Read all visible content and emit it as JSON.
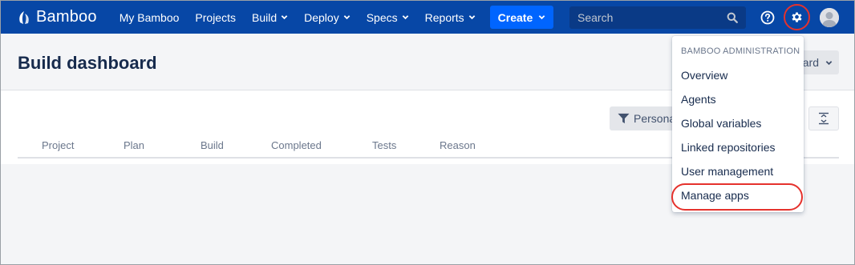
{
  "app": {
    "name": "Bamboo"
  },
  "nav": {
    "items": [
      {
        "label": "My Bamboo",
        "dropdown": false
      },
      {
        "label": "Projects",
        "dropdown": false
      },
      {
        "label": "Build",
        "dropdown": true
      },
      {
        "label": "Deploy",
        "dropdown": true
      },
      {
        "label": "Specs",
        "dropdown": true
      },
      {
        "label": "Reports",
        "dropdown": true
      }
    ],
    "create_label": "Create",
    "search_placeholder": "Search"
  },
  "page": {
    "title": "Build dashboard",
    "header_button_label": "ard"
  },
  "toolbar": {
    "filter_label": "Personal"
  },
  "table": {
    "columns": [
      "Project",
      "Plan",
      "Build",
      "Completed",
      "Tests",
      "Reason"
    ]
  },
  "admin_menu": {
    "heading": "BAMBOO ADMINISTRATION",
    "items": [
      "Overview",
      "Agents",
      "Global variables",
      "Linked repositories",
      "User management",
      "Manage apps"
    ],
    "highlighted": "Manage apps"
  },
  "colors": {
    "nav_bg": "#0747a6",
    "create_bg": "#0065ff",
    "highlight_ring": "#e5322d"
  },
  "icons": {
    "logo": "bamboo-logo-icon",
    "search": "search-icon",
    "help": "help-icon",
    "settings": "gear-icon",
    "user": "avatar",
    "filter": "filter-icon",
    "toggle": "expand-collapse-icon"
  }
}
